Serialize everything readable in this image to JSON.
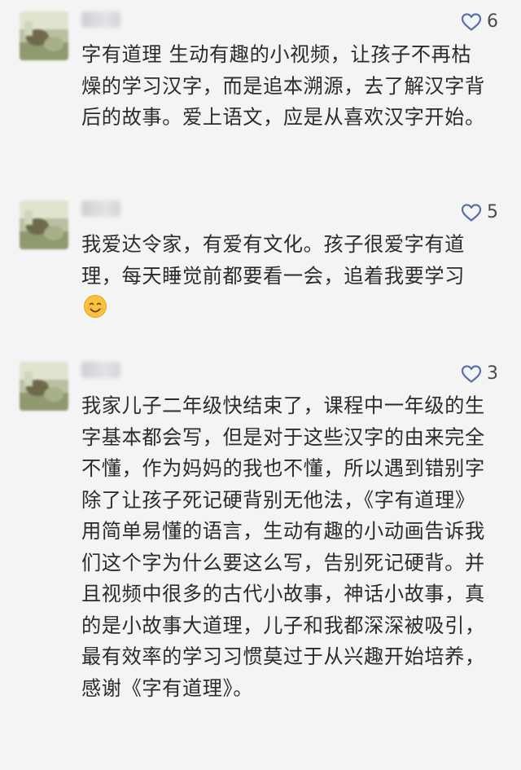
{
  "comments": [
    {
      "likes": "6",
      "text": "字有道理 生动有趣的小视频，让孩子不再枯燥的学习汉字，而是追本溯源，去了解汉字背后的故事。爱上语文，应是从喜欢汉字开始。"
    },
    {
      "likes": "5",
      "text": "我爱达令家，有爱有文化。孩子很爱字有道理，每天睡觉前都要看一会，追着我要学习",
      "trailing_icon": "smiling-face-emoji"
    },
    {
      "likes": "3",
      "text": "我家儿子二年级快结束了，课程中一年级的生字基本都会写，但是对于这些汉字的由来完全不懂，作为妈妈的我也不懂，所以遇到错别字除了让孩子死记硬背别无他法，《字有道理》用简单易懂的语言，生动有趣的小动画告诉我们这个字为什么要这么写，告别死记硬背。并且视频中很多的古代小故事，神话小故事，真的是小故事大道理，儿子和我都深深被吸引，最有效率的学习习惯莫过于从兴趣开始培养，感谢《字有道理》。"
    }
  ],
  "icons": {
    "like": "heart-outline-icon",
    "avatar": "blurred-avatar"
  },
  "colors": {
    "background": "#f4f4f4",
    "text": "#2b2b2b",
    "like_icon": "#5a6fa8",
    "like_count": "#4c4c4c",
    "emoji_face": "#f7c33a"
  }
}
